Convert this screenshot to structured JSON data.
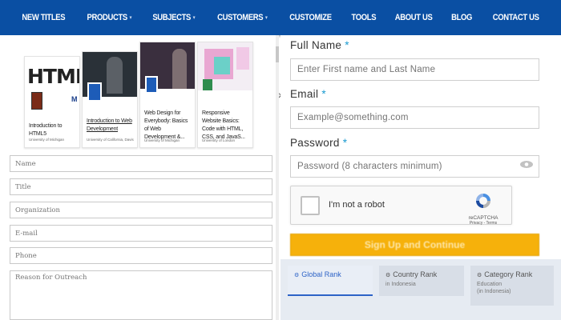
{
  "nav": {
    "items": [
      {
        "label": "NEW TITLES",
        "dropdown": false
      },
      {
        "label": "PRODUCTS",
        "dropdown": true
      },
      {
        "label": "SUBJECTS",
        "dropdown": true
      },
      {
        "label": "CUSTOMERS",
        "dropdown": true
      },
      {
        "label": "CUSTOMIZE",
        "dropdown": false
      },
      {
        "label": "TOOLS",
        "dropdown": false
      },
      {
        "label": "ABOUT US",
        "dropdown": false
      },
      {
        "label": "BLOG",
        "dropdown": false
      },
      {
        "label": "CONTACT US",
        "dropdown": false
      }
    ],
    "caret": "▾"
  },
  "carousel": {
    "cards": [
      {
        "thumb_text": "HTML",
        "title": "Introduction to HTML5",
        "org": "University of Michigan"
      },
      {
        "title": "Introduction to Web Development",
        "org": "University of California, Davis"
      },
      {
        "title": "Web Design for Everybody: Basics of Web Development &...",
        "org": "University of Michigan"
      },
      {
        "title": "Responsive Website Basics: Code with HTML, CSS, and JavaS...",
        "org": "University of London"
      }
    ],
    "next_icon": "›"
  },
  "contact_form": {
    "name_placeholder": "Name",
    "title_placeholder": "Title",
    "organization_placeholder": "Organization",
    "email_placeholder": "E-mail",
    "phone_placeholder": "Phone",
    "reason_placeholder": "Reason for Outreach"
  },
  "signup": {
    "full_name_label": "Full Name",
    "full_name_placeholder": "Enter First name and Last Name",
    "email_label": "Email",
    "email_placeholder": "Example@something.com",
    "password_label": "Password",
    "password_placeholder": "Password (8 characters minimum)",
    "required_mark": "*",
    "captcha": {
      "text": "I'm not a robot",
      "brand": "reCAPTCHA",
      "links": "Privacy - Terms"
    },
    "submit_label": "Sign Up and Continue"
  },
  "rank_tabs": [
    {
      "label": "Global Rank",
      "sub": ""
    },
    {
      "label": "Country Rank",
      "sub": "in Indonesia"
    },
    {
      "label": "Category Rank",
      "sub": "Education\n(in Indonesia)"
    }
  ],
  "colors": {
    "nav_bg": "#0a4fa3",
    "accent": "#f6b10b",
    "rank_accent": "#2d63c7"
  }
}
